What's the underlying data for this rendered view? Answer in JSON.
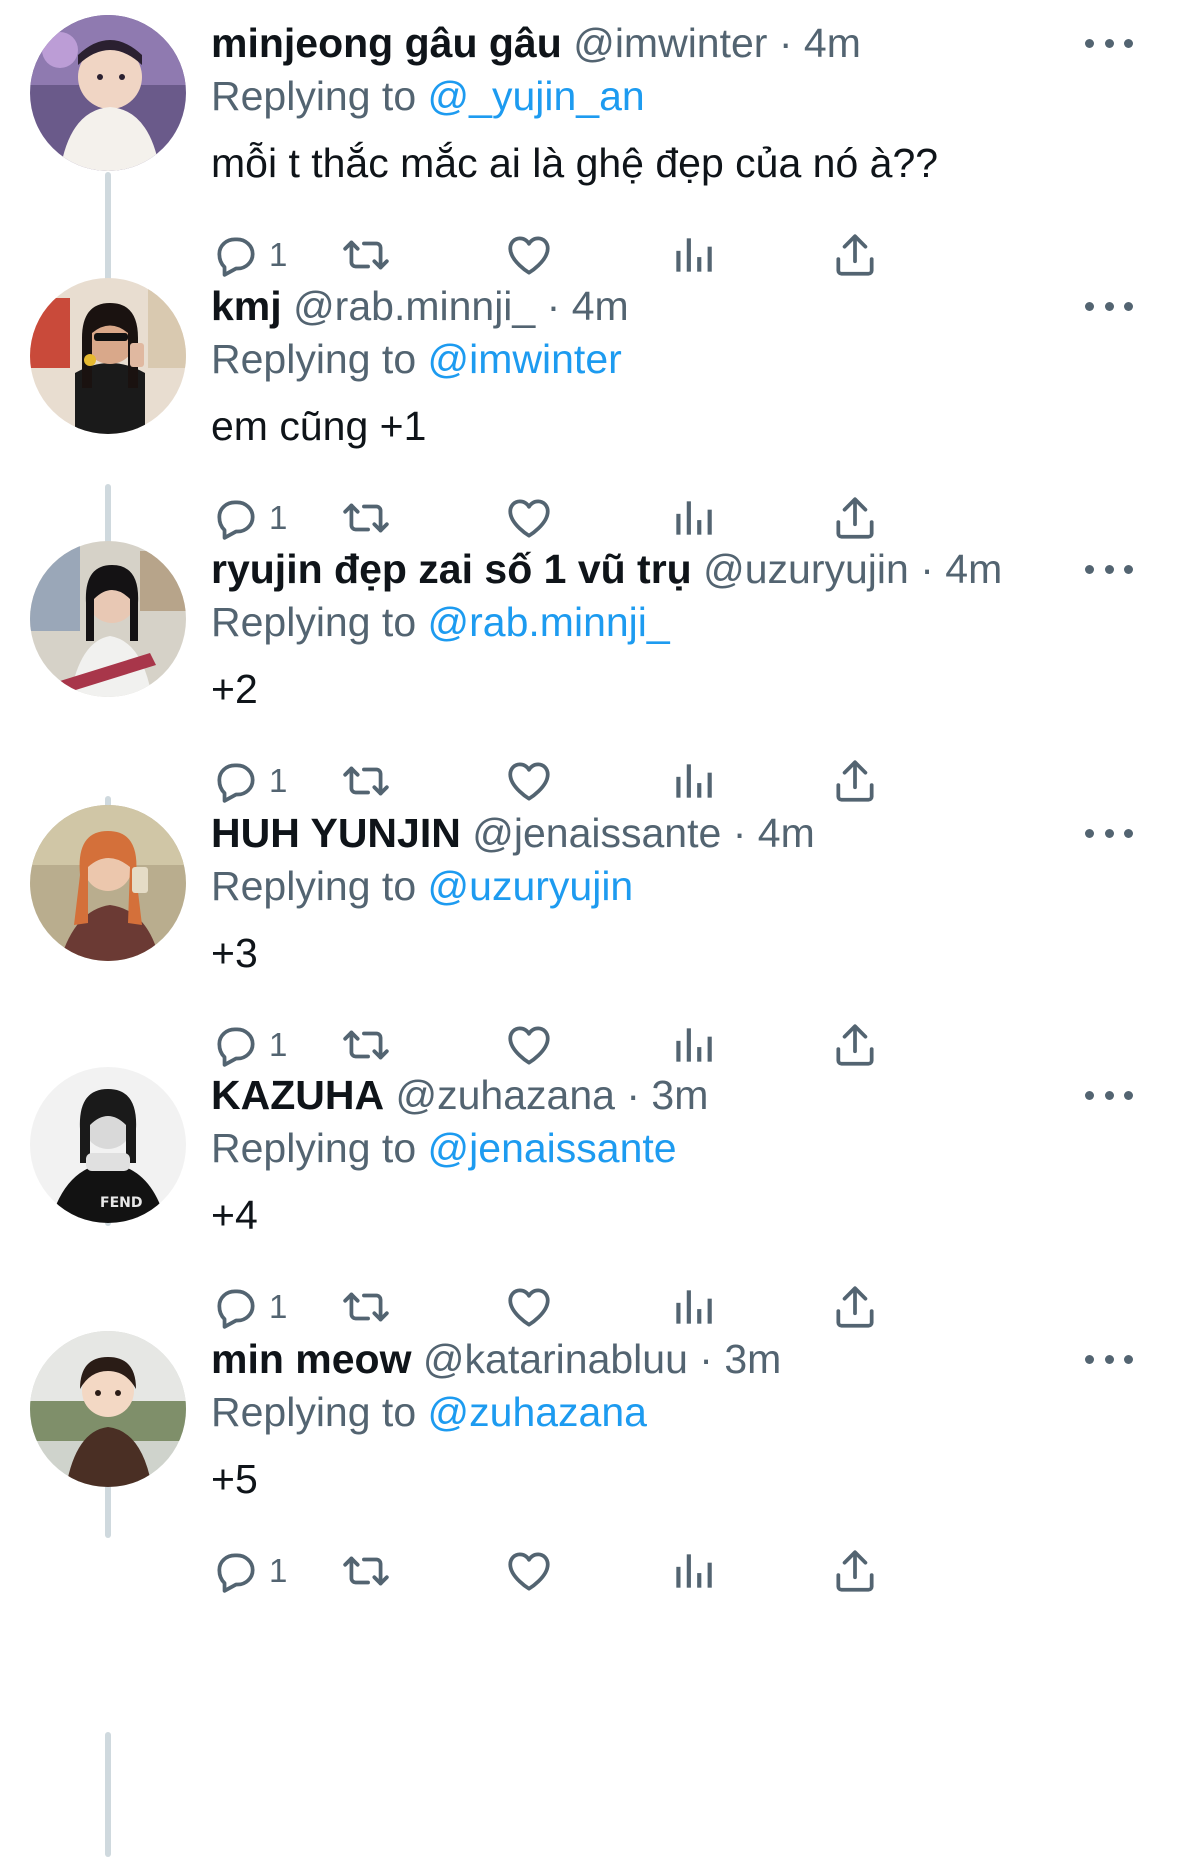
{
  "colors": {
    "text": "#0f1419",
    "secondary": "#536471",
    "link": "#1d9bf0",
    "thread_line": "#cfd9de"
  },
  "icons": {
    "reply": "speech-bubble-icon",
    "retweet": "retweet-icon",
    "like": "heart-icon",
    "views": "bar-chart-icon",
    "share": "share-upload-icon",
    "more": "ellipsis-icon"
  },
  "separator": "·",
  "tweets": [
    {
      "name": "minjeong gâu gâu",
      "handle": "@imwinter",
      "time": "4m",
      "reply_prefix": "Replying to",
      "reply_to": "@_yujin_an",
      "text": "mỗi t thắc mắc ai là ghệ đẹp của nó à??",
      "reply_count": "1"
    },
    {
      "name": "kmj",
      "handle": "@rab.minnji_",
      "time": "4m",
      "reply_prefix": "Replying to",
      "reply_to": "@imwinter",
      "text": "em cũng +1",
      "reply_count": "1"
    },
    {
      "name": "ryujin đẹp zai số 1 vũ trụ",
      "handle": "@uzuryujin",
      "time": "4m",
      "reply_prefix": "Replying to",
      "reply_to": "@rab.minnji_",
      "text": "+2",
      "reply_count": "1"
    },
    {
      "name": "HUH YUNJIN",
      "handle": "@jenaissante",
      "time": "4m",
      "reply_prefix": "Replying to",
      "reply_to": "@uzuryujin",
      "text": "+3",
      "reply_count": "1"
    },
    {
      "name": "KAZUHA",
      "handle": "@zuhazana",
      "time": "3m",
      "reply_prefix": "Replying to",
      "reply_to": "@jenaissante",
      "text": "+4",
      "reply_count": "1"
    },
    {
      "name": "min meow",
      "handle": "@katarinabluu",
      "time": "3m",
      "reply_prefix": "Replying to",
      "reply_to": "@zuhazana",
      "text": "+5",
      "reply_count": "1"
    }
  ]
}
